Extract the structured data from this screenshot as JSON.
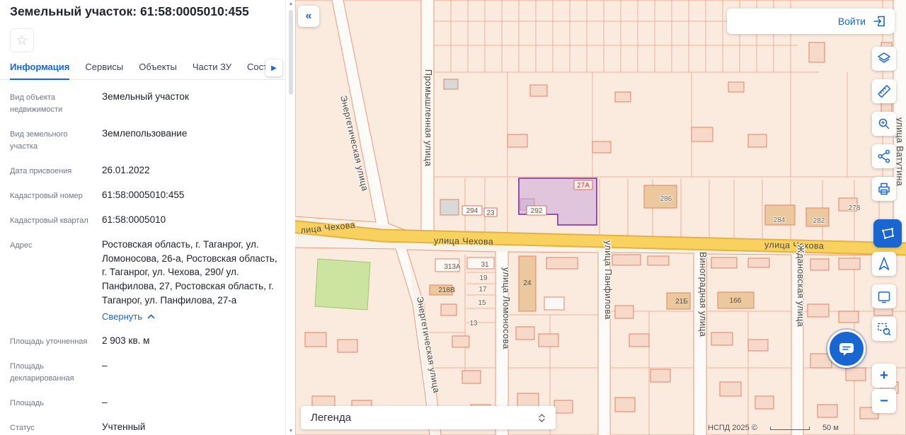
{
  "panel": {
    "title": "Земельный участок: 61:58:0005010:455",
    "favorite_icon": "☆",
    "tabs_next_icon": "▶",
    "scroll_up_icon": "▲",
    "scroll_down_icon": "▼",
    "tabs": [
      "Информация",
      "Сервисы",
      "Объекты",
      "Части ЗУ",
      "Состав"
    ],
    "address_collapse_label": "Свернуть",
    "fields": [
      {
        "label": "Вид объекта недвижимости",
        "value": "Земельный участок"
      },
      {
        "label": "Вид земельного участка",
        "value": "Землепользование"
      },
      {
        "label": "Дата присвоения",
        "value": "26.01.2022"
      },
      {
        "label": "Кадастровый номер",
        "value": "61:58:0005010:455"
      },
      {
        "label": "Кадастровый квартал",
        "value": "61:58:0005010"
      },
      {
        "label": "Адрес",
        "value": "Ростовская область, г. Таганрог, ул. Ломоносова, 26-а, Ростовская область, г. Таганрог, ул. Чехова, 290/ ул. Панфилова, 27, Ростовская область, г. Таганрог, ул. Панфилова, 27-а"
      },
      {
        "label": "Площадь уточненная",
        "value": "2 903 кв. м"
      },
      {
        "label": "Площадь декларированная",
        "value": "–"
      },
      {
        "label": "Площадь",
        "value": "–"
      },
      {
        "label": "Статус",
        "value": "Учтенный"
      }
    ]
  },
  "map": {
    "collapse_icon": "«",
    "login_label": "Войти",
    "legend_label": "Легенда",
    "attribution": "НСПД 2025 ©",
    "scale_label": "50 м",
    "zoom_in": "+",
    "zoom_out": "−",
    "accent_color": "#1966d2",
    "selected_parcel_color": "#8a3fb0",
    "street_labels": [
      "лица Чехова",
      "улица Чехова",
      "улица Чехова",
      "Промышленная улица",
      "Энергетическая улица",
      "Энергетическая улица",
      "улица Ломоносова",
      "улица Панфилова",
      "Виноградная улица",
      "Ждановская улица",
      "улица Ватутина"
    ],
    "parcel_labels": [
      "294",
      "23",
      "292",
      "27А",
      "286",
      "284",
      "282",
      "278",
      "313А",
      "31",
      "19",
      "17",
      "15",
      "13",
      "218В",
      "24",
      "21Б",
      "166"
    ]
  }
}
